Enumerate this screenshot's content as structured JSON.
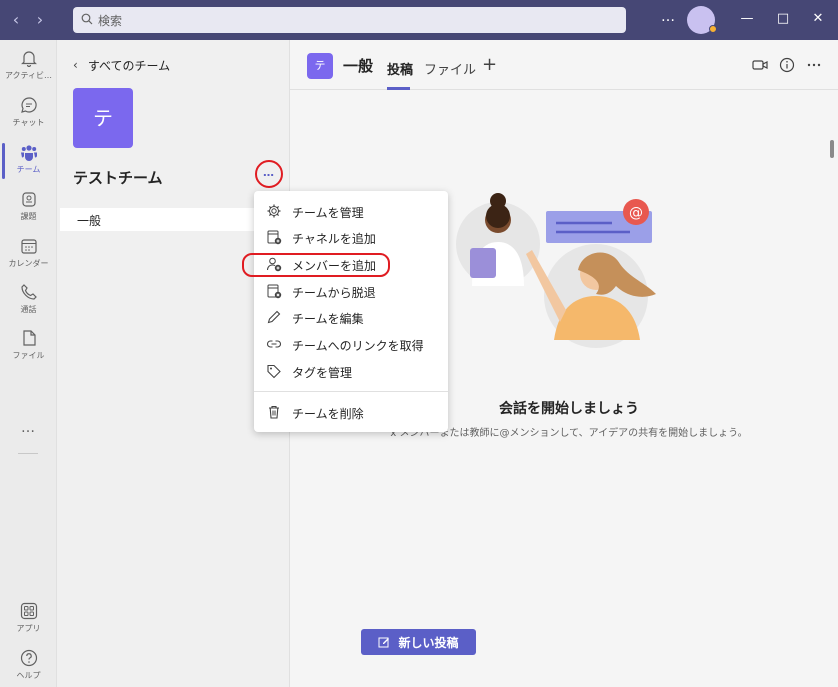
{
  "titlebar": {
    "search_placeholder": "検索",
    "more_label": "…"
  },
  "appbar": {
    "items": [
      {
        "label": "アクティビ…",
        "icon": "bell-icon"
      },
      {
        "label": "チャット",
        "icon": "chat-icon"
      },
      {
        "label": "チーム",
        "icon": "teams-icon",
        "active": true
      },
      {
        "label": "課題",
        "icon": "assignments-icon"
      },
      {
        "label": "カレンダー",
        "icon": "calendar-icon"
      },
      {
        "label": "通話",
        "icon": "phone-icon"
      },
      {
        "label": "ファイル",
        "icon": "file-icon"
      }
    ],
    "more_label": "…",
    "bottom": [
      {
        "label": "アプリ",
        "icon": "apps-icon"
      },
      {
        "label": "ヘルプ",
        "icon": "help-icon"
      }
    ]
  },
  "teampanel": {
    "back_label": "すべてのチーム",
    "team_initial": "テ",
    "team_name": "テストチーム",
    "more_label": "…",
    "channels": [
      {
        "label": "一般"
      }
    ]
  },
  "main": {
    "channel_initial": "テ",
    "channel_name": "一般",
    "tabs": [
      {
        "label": "投稿",
        "active": true
      },
      {
        "label": "ファイル"
      }
    ],
    "add_tab_label": "+",
    "empty_title": "会話を開始しましょう",
    "empty_subtitle": "ⅹ メンバーまたは教師に@メンションして、アイデアの共有を開始しましょう。",
    "new_post_label": "新しい投稿"
  },
  "context_menu": {
    "items": [
      {
        "label": "チームを管理",
        "icon": "gear-icon"
      },
      {
        "label": "チャネルを追加",
        "icon": "add-channel-icon"
      },
      {
        "label": "メンバーを追加",
        "icon": "add-member-icon",
        "highlighted": true
      },
      {
        "label": "チームから脱退",
        "icon": "leave-team-icon"
      },
      {
        "label": "チームを編集",
        "icon": "pencil-icon"
      },
      {
        "label": "チームへのリンクを取得",
        "icon": "link-icon"
      },
      {
        "label": "タグを管理",
        "icon": "tag-icon"
      },
      {
        "label": "チームを削除",
        "icon": "trash-icon"
      }
    ]
  },
  "colors": {
    "titlebar": "#464775",
    "accent": "#5b5fc7",
    "team_avatar": "#7b68ee",
    "highlight": "#e01c22"
  }
}
